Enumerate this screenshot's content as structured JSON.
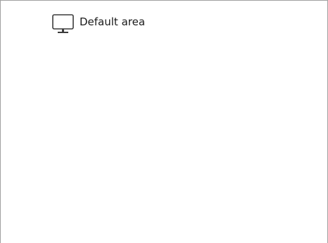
{
  "area_list": {
    "items": [
      {
        "label": "Default area",
        "icon": "monitor-icon"
      }
    ]
  }
}
